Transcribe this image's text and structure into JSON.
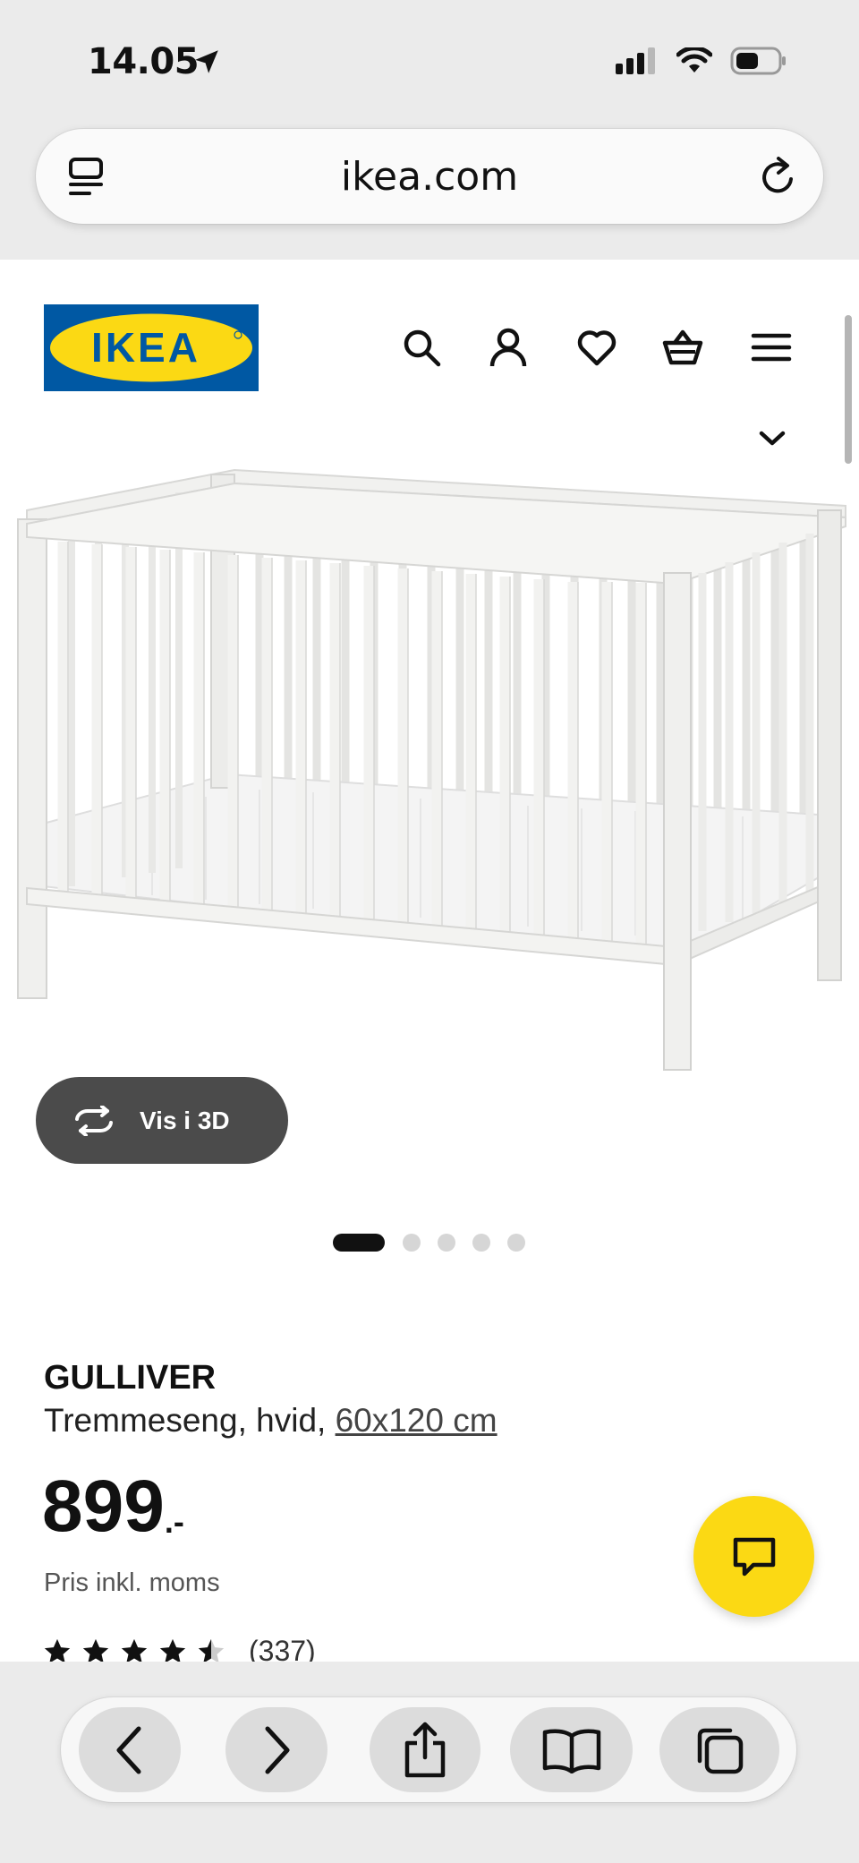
{
  "status_bar": {
    "time": "14.05",
    "icons": [
      "location-arrow-icon",
      "cellular-signal-icon",
      "wifi-icon",
      "battery-icon"
    ]
  },
  "browser": {
    "url": "ikea.com",
    "tabs_icon": "tab-overview-icon",
    "reload_icon": "reload-icon",
    "toolbar": [
      "back-icon",
      "forward-icon",
      "share-icon",
      "bookmarks-icon",
      "tabs-icon"
    ]
  },
  "header": {
    "logo_text": "IKEA",
    "icons": [
      "search-icon",
      "user-icon",
      "heart-icon",
      "basket-icon",
      "menu-icon"
    ]
  },
  "gallery": {
    "view_3d_label": "Vis i 3D",
    "dots_total": 5,
    "active_index": 0
  },
  "product": {
    "name": "GULLIVER",
    "description": "Tremmeseng, hvid, ",
    "size": "60x120 cm",
    "price": "899",
    "price_suffix": ".-",
    "price_note": "Pris inkl. moms",
    "rating_stars": 4.5,
    "review_count": "(337)"
  },
  "colors": {
    "ikea_blue": "#0058A3",
    "ikea_yellow": "#FBD914",
    "button_dark": "#4B4B4B"
  }
}
